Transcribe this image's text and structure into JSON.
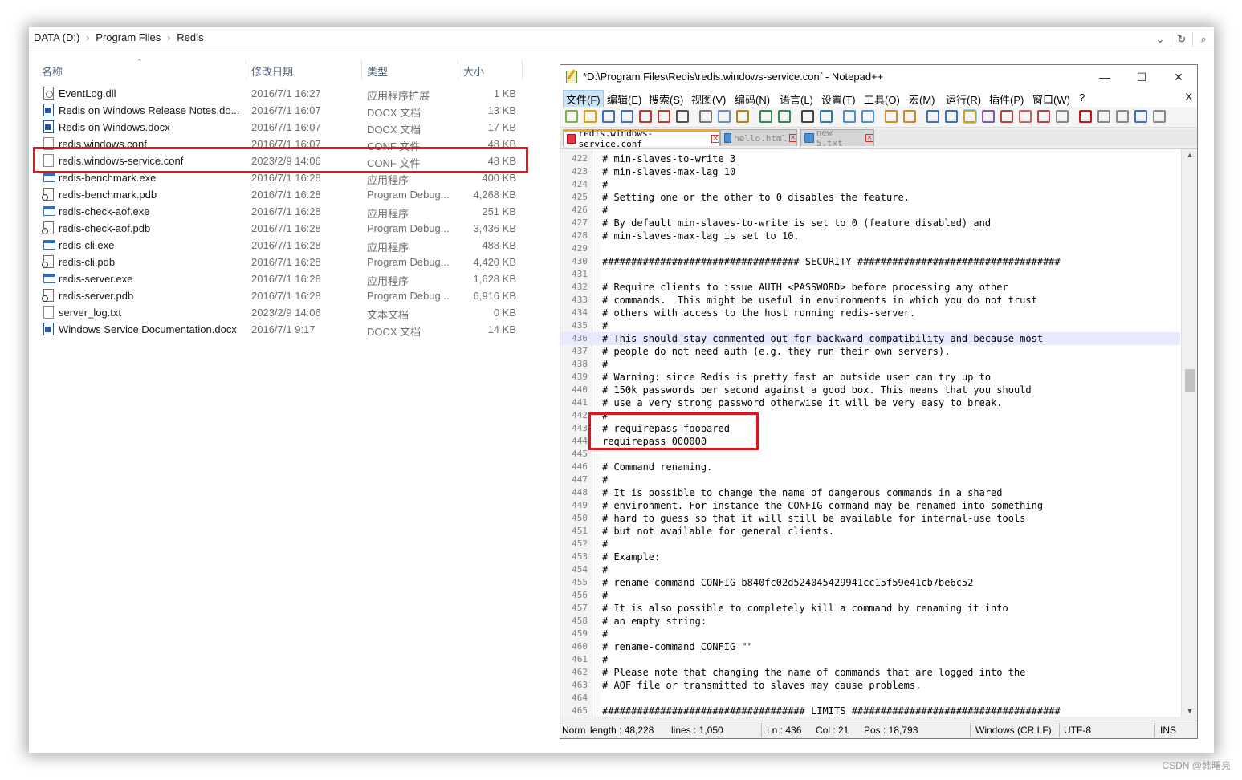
{
  "explorer": {
    "breadcrumb": [
      "DATA (D:)",
      "Program Files",
      "Redis"
    ],
    "columns": {
      "name": "名称",
      "date": "修改日期",
      "type": "类型",
      "size": "大小"
    },
    "files": [
      {
        "name": "EventLog.dll",
        "date": "2016/7/1 16:27",
        "type": "应用程序扩展",
        "size": "1 KB",
        "icon": "dll-icon"
      },
      {
        "name": "Redis on Windows Release Notes.do...",
        "date": "2016/7/1 16:07",
        "type": "DOCX 文档",
        "size": "13 KB",
        "icon": "word-doc-icon"
      },
      {
        "name": "Redis on Windows.docx",
        "date": "2016/7/1 16:07",
        "type": "DOCX 文档",
        "size": "17 KB",
        "icon": "word-doc-icon"
      },
      {
        "name": "redis.windows.conf",
        "date": "2016/7/1 16:07",
        "type": "CONF 文件",
        "size": "48 KB",
        "icon": "file-icon"
      },
      {
        "name": "redis.windows-service.conf",
        "date": "2023/2/9 14:06",
        "type": "CONF 文件",
        "size": "48 KB",
        "icon": "file-icon"
      },
      {
        "name": "redis-benchmark.exe",
        "date": "2016/7/1 16:28",
        "type": "应用程序",
        "size": "400 KB",
        "icon": "exe-icon"
      },
      {
        "name": "redis-benchmark.pdb",
        "date": "2016/7/1 16:28",
        "type": "Program Debug...",
        "size": "4,268 KB",
        "icon": "pdb-icon"
      },
      {
        "name": "redis-check-aof.exe",
        "date": "2016/7/1 16:28",
        "type": "应用程序",
        "size": "251 KB",
        "icon": "exe-icon"
      },
      {
        "name": "redis-check-aof.pdb",
        "date": "2016/7/1 16:28",
        "type": "Program Debug...",
        "size": "3,436 KB",
        "icon": "pdb-icon"
      },
      {
        "name": "redis-cli.exe",
        "date": "2016/7/1 16:28",
        "type": "应用程序",
        "size": "488 KB",
        "icon": "exe-icon"
      },
      {
        "name": "redis-cli.pdb",
        "date": "2016/7/1 16:28",
        "type": "Program Debug...",
        "size": "4,420 KB",
        "icon": "pdb-icon"
      },
      {
        "name": "redis-server.exe",
        "date": "2016/7/1 16:28",
        "type": "应用程序",
        "size": "1,628 KB",
        "icon": "exe-icon"
      },
      {
        "name": "redis-server.pdb",
        "date": "2016/7/1 16:28",
        "type": "Program Debug...",
        "size": "6,916 KB",
        "icon": "pdb-icon"
      },
      {
        "name": "server_log.txt",
        "date": "2023/2/9 14:06",
        "type": "文本文档",
        "size": "0 KB",
        "icon": "file-icon"
      },
      {
        "name": "Windows Service Documentation.docx",
        "date": "2016/7/1 9:17",
        "type": "DOCX 文档",
        "size": "14 KB",
        "icon": "word-doc-icon"
      }
    ]
  },
  "notepad": {
    "title": "*D:\\Program Files\\Redis\\redis.windows-service.conf - Notepad++",
    "window_buttons": {
      "minimize": "—",
      "maximize": "☐",
      "close": "✕"
    },
    "menu": [
      "文件(F)",
      "编辑(E)",
      "搜索(S)",
      "视图(V)",
      "编码(N)",
      "语言(L)",
      "设置(T)",
      "工具(O)",
      "宏(M)",
      "运行(R)",
      "插件(P)",
      "窗口(W)",
      "?"
    ],
    "menu_close": "X",
    "tabs": [
      {
        "label": "redis.windows-service.conf",
        "active": true
      },
      {
        "label": "hello.html",
        "active": false
      },
      {
        "label": "new 5.txt",
        "active": false
      }
    ],
    "lines": [
      {
        "n": "422",
        "text": "# min-slaves-to-write 3"
      },
      {
        "n": "423",
        "text": "# min-slaves-max-lag 10"
      },
      {
        "n": "424",
        "text": "#"
      },
      {
        "n": "425",
        "text": "# Setting one or the other to 0 disables the feature."
      },
      {
        "n": "426",
        "text": "#"
      },
      {
        "n": "427",
        "text": "# By default min-slaves-to-write is set to 0 (feature disabled) and"
      },
      {
        "n": "428",
        "text": "# min-slaves-max-lag is set to 10."
      },
      {
        "n": "429",
        "text": ""
      },
      {
        "n": "430",
        "text": "################################## SECURITY ###################################"
      },
      {
        "n": "431",
        "text": ""
      },
      {
        "n": "432",
        "text": "# Require clients to issue AUTH <PASSWORD> before processing any other"
      },
      {
        "n": "433",
        "text": "# commands.  This might be useful in environments in which you do not trust"
      },
      {
        "n": "434",
        "text": "# others with access to the host running redis-server."
      },
      {
        "n": "435",
        "text": "#"
      },
      {
        "n": "436",
        "text": "# This should stay commented out for backward compatibility and because most"
      },
      {
        "n": "437",
        "text": "# people do not need auth (e.g. they run their own servers)."
      },
      {
        "n": "438",
        "text": "#"
      },
      {
        "n": "439",
        "text": "# Warning: since Redis is pretty fast an outside user can try up to"
      },
      {
        "n": "440",
        "text": "# 150k passwords per second against a good box. This means that you should"
      },
      {
        "n": "441",
        "text": "# use a very strong password otherwise it will be very easy to break."
      },
      {
        "n": "442",
        "text": "#"
      },
      {
        "n": "443",
        "text": "# requirepass foobared"
      },
      {
        "n": "444",
        "text": "requirepass 000000"
      },
      {
        "n": "445",
        "text": ""
      },
      {
        "n": "446",
        "text": "# Command renaming."
      },
      {
        "n": "447",
        "text": "#"
      },
      {
        "n": "448",
        "text": "# It is possible to change the name of dangerous commands in a shared"
      },
      {
        "n": "449",
        "text": "# environment. For instance the CONFIG command may be renamed into something"
      },
      {
        "n": "450",
        "text": "# hard to guess so that it will still be available for internal-use tools"
      },
      {
        "n": "451",
        "text": "# but not available for general clients."
      },
      {
        "n": "452",
        "text": "#"
      },
      {
        "n": "453",
        "text": "# Example:"
      },
      {
        "n": "454",
        "text": "#"
      },
      {
        "n": "455",
        "text": "# rename-command CONFIG b840fc02d524045429941cc15f59e41cb7be6c52"
      },
      {
        "n": "456",
        "text": "#"
      },
      {
        "n": "457",
        "text": "# It is also possible to completely kill a command by renaming it into"
      },
      {
        "n": "458",
        "text": "# an empty string:"
      },
      {
        "n": "459",
        "text": "#"
      },
      {
        "n": "460",
        "text": "# rename-command CONFIG \"\""
      },
      {
        "n": "461",
        "text": "#"
      },
      {
        "n": "462",
        "text": "# Please note that changing the name of commands that are logged into the"
      },
      {
        "n": "463",
        "text": "# AOF file or transmitted to slaves may cause problems."
      },
      {
        "n": "464",
        "text": ""
      },
      {
        "n": "465",
        "text": "################################### LIMITS ####################################"
      }
    ],
    "current_line": "436",
    "status": {
      "type": "Norm",
      "length": "length : 48,228",
      "lines": "lines : 1,050",
      "ln": "Ln : 436",
      "col": "Col : 21",
      "pos": "Pos : 18,793",
      "eol": "Windows (CR LF)",
      "encoding": "UTF-8",
      "mode": "INS"
    }
  },
  "watermark": "CSDN @韩曙亮",
  "colors": {
    "highlight_box": "#e0141e",
    "current_line": "#e8e8ff",
    "tab_accent": "#f5a623"
  }
}
